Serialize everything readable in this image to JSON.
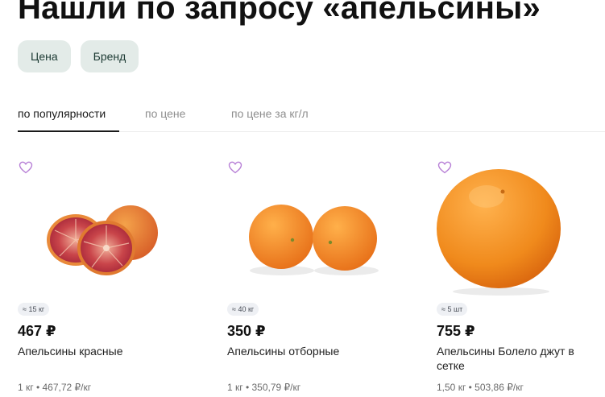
{
  "header": {
    "title": "Нашли по запросу «апельсины»"
  },
  "filters": [
    {
      "label": "Цена"
    },
    {
      "label": "Бренд"
    }
  ],
  "sort_tabs": [
    {
      "label": "по популярности",
      "active": true
    },
    {
      "label": "по цене",
      "active": false
    },
    {
      "label": "по цене за кг/л",
      "active": false
    }
  ],
  "products": [
    {
      "badge": "≈ 15 кг",
      "price": "467 ₽",
      "name": "Апельсины красные",
      "unit_price": "1 кг • 467,72 ₽/кг",
      "image": "blood-oranges-image"
    },
    {
      "badge": "≈ 40 кг",
      "price": "350 ₽",
      "name": "Апельсины отборные",
      "unit_price": "1 кг • 350,79 ₽/кг",
      "image": "oranges-pair-image"
    },
    {
      "badge": "≈ 5 шт",
      "price": "755 ₽",
      "name": "Апельсины Болело джут в сетке",
      "unit_price": "1,50 кг • 503,86 ₽/кг",
      "image": "big-orange-image"
    }
  ],
  "colors": {
    "accent_heart": "#b77fd6",
    "chip_bg": "#e3ebe8",
    "orange": "#f08a1c"
  },
  "icons": {
    "favorite": "heart-outline-icon"
  }
}
